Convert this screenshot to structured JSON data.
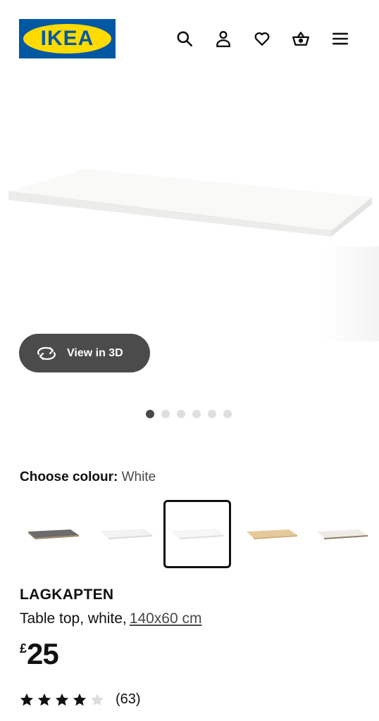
{
  "header": {
    "logo_text": "IKEA",
    "icons": [
      "search-icon",
      "user-icon",
      "heart-icon",
      "basket-icon",
      "hamburger-menu-icon"
    ]
  },
  "gallery": {
    "view3d_label": "View in 3D",
    "image_count": 6,
    "active_index": 0
  },
  "colour": {
    "label": "Choose colour:",
    "value": "White",
    "options": [
      {
        "name": "dark grey",
        "color": "#6b6b6b"
      },
      {
        "name": "white stained",
        "color": "#f0f0f0"
      },
      {
        "name": "white",
        "color": "#f6f6f6",
        "selected": true
      },
      {
        "name": "birch effect",
        "color": "#e6c99a"
      },
      {
        "name": "white/anthracite",
        "color": "#ece9e4"
      }
    ]
  },
  "product": {
    "name": "LAGKAPTEN",
    "description": "Table top, white,",
    "size": "140x60 cm",
    "currency": "£",
    "price": "25",
    "rating": 4,
    "rating_max": 5,
    "review_count": "(63)"
  },
  "colors": {
    "brand_blue": "#0058a3",
    "brand_yellow": "#ffdb00",
    "view3d_bg": "#4b4b4b"
  }
}
